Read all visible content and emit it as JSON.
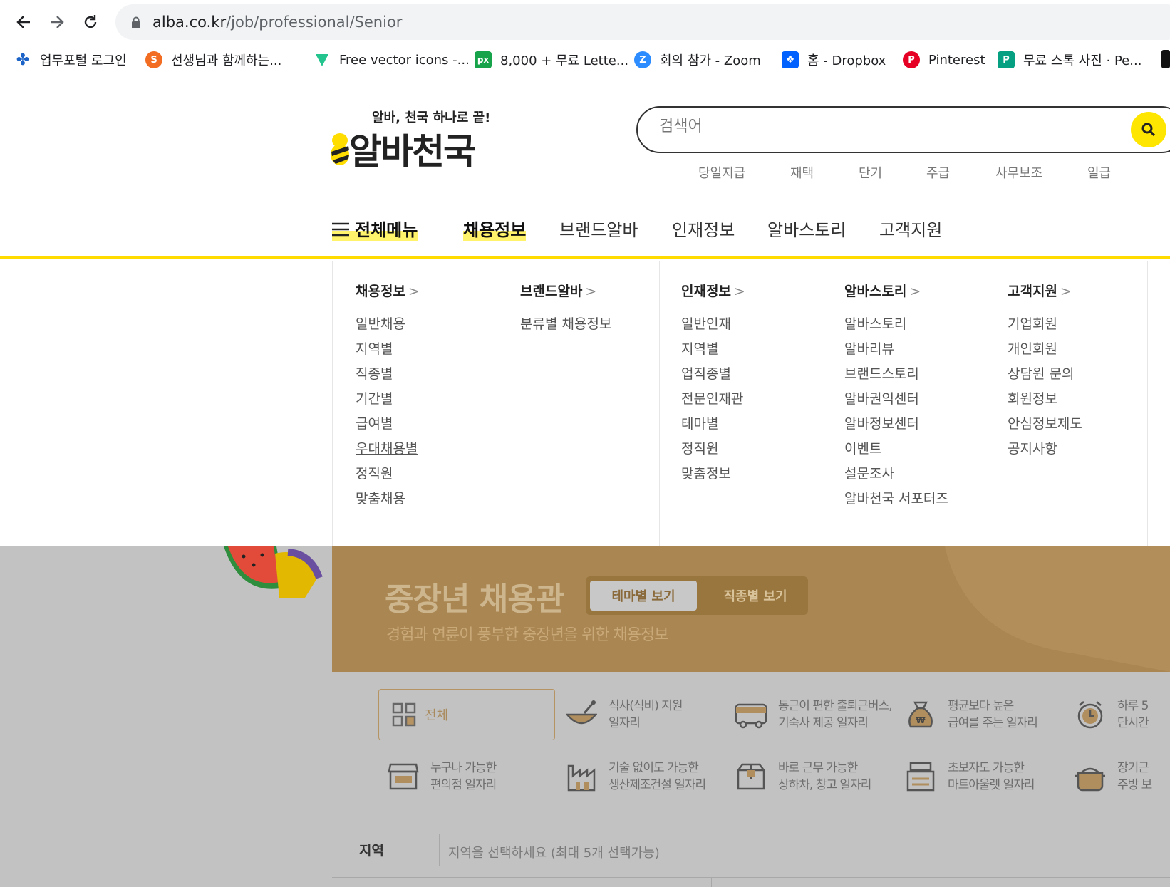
{
  "browser": {
    "url_host": "alba.co.kr",
    "url_path": "/job/professional/Senior",
    "bookmarks": [
      {
        "label": "업무포털 로그인",
        "icon": "portal-icon",
        "color": "#1b63c6"
      },
      {
        "label": "선생님과 함께하는...",
        "icon": "s-icon",
        "color": "#f26d21"
      },
      {
        "label": "Free vector icons -...",
        "icon": "vector-icon",
        "color": "#23c48e"
      },
      {
        "label": "8,000 + 무료 Lette...",
        "icon": "px-icon",
        "color": "#17a34a"
      },
      {
        "label": "회의 참가 - Zoom",
        "icon": "zoom-icon",
        "color": "#2d8cff"
      },
      {
        "label": "홈 - Dropbox",
        "icon": "dropbox-icon",
        "color": "#0061fe"
      },
      {
        "label": "Pinterest",
        "icon": "pinterest-icon",
        "color": "#e60023"
      },
      {
        "label": "무료 스톡 사진 · Pe...",
        "icon": "pexels-icon",
        "color": "#05a081"
      }
    ]
  },
  "header": {
    "tagline": "알바, 천국 하나로 끝!",
    "logo": "알바천국",
    "search_placeholder": "검색어",
    "quick_links": [
      "당일지급",
      "재택",
      "단기",
      "주급",
      "사무보조",
      "일급"
    ],
    "accent": "#ffe600"
  },
  "gnb": {
    "all_menu": "전체메뉴",
    "items": [
      "채용정보",
      "브랜드알바",
      "인재정보",
      "알바스토리",
      "고객지원"
    ]
  },
  "dropdown": [
    {
      "title": "채용정보",
      "items": [
        "일반채용",
        "지역별",
        "직종별",
        "기간별",
        "급여별",
        "우대채용별",
        "정직원",
        "맞춤채용"
      ]
    },
    {
      "title": "브랜드알바",
      "items": [
        "분류별 채용정보"
      ]
    },
    {
      "title": "인재정보",
      "items": [
        "일반인재",
        "지역별",
        "업직종별",
        "전문인재관",
        "테마별",
        "정직원",
        "맞춤정보"
      ]
    },
    {
      "title": "알바스토리",
      "items": [
        "알바스토리",
        "알바리뷰",
        "브랜드스토리",
        "알바권익센터",
        "알바정보센터",
        "이벤트",
        "설문조사",
        "알바천국 서포터즈"
      ]
    },
    {
      "title": "고객지원",
      "items": [
        "기업회원",
        "개인회원",
        "상담원 문의",
        "회원정보",
        "안심정보제도",
        "공지사항"
      ]
    }
  ],
  "banner": {
    "title": "중장년 채용관",
    "subtitle": "경험과 연륜이 풍부한 중장년을 위한 채용정보",
    "tab_theme": "테마별 보기",
    "tab_job": "직종별 보기"
  },
  "themes": {
    "all": "전체",
    "items": [
      {
        "text": "식사(식비) 지원\n일자리",
        "icon": "meal-icon"
      },
      {
        "text": "통근이 편한 출퇴근버스,\n기숙사 제공 일자리",
        "icon": "bus-icon"
      },
      {
        "text": "평균보다 높은\n급여를 주는 일자리",
        "icon": "money-bag-icon"
      },
      {
        "text": "하루 5\n단시간",
        "icon": "clock-icon"
      },
      {
        "text": "누구나 가능한\n편의점 일자리",
        "icon": "store-icon"
      },
      {
        "text": "기술 없이도 가능한\n생산제조건설 일자리",
        "icon": "factory-icon"
      },
      {
        "text": "바로 근무 가능한\n상하차, 창고 일자리",
        "icon": "box-icon"
      },
      {
        "text": "초보자도 가능한\n마트아울렛 일자리",
        "icon": "register-icon"
      },
      {
        "text": "장기근\n주방 보",
        "icon": "pot-icon"
      }
    ]
  },
  "region": {
    "label": "지역",
    "placeholder": "지역을 선택하세요 (최대 5개 선택가능)"
  }
}
